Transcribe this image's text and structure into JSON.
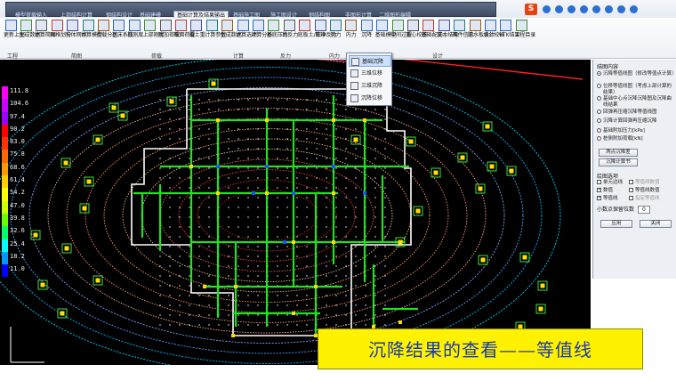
{
  "tabs": [
    "模型荷载输入",
    "上部结构计算",
    "钢结构设计",
    "基础建模",
    "基础计算及结果输出",
    "基础施工图",
    "施工图设计",
    "钢结构图",
    "非图形计算",
    "二维图形编辑"
  ],
  "active_tab_index": 4,
  "ribbon": {
    "buttons": [
      "更新上部",
      "生成数据",
      "计算简图",
      "网格划分",
      "实体网格",
      "计算模型",
      "荷载分区",
      "基床系数",
      "柱刚度",
      "上部刚度",
      "附加荷载",
      "桩面荷载",
      "覆土重",
      "计算参数",
      "生成数据",
      "计算选项",
      "计算分析",
      "基底压力",
      "桩反力",
      "底板土/桩净反力",
      "弯矩",
      "剪力",
      "内力",
      "沉降",
      "基础模型",
      "中间过程",
      "重心校核",
      "基础配筋",
      "文本结果",
      "构件信息",
      "防水板设计",
      "承台校核",
      "VTK结果",
      "工程目录"
    ],
    "groups": [
      "工程",
      "简图",
      "荷载",
      "计算",
      "反力",
      "内力",
      "设计"
    ]
  },
  "dropdown": {
    "items": [
      "基础沉降",
      "三维位移",
      "三维沉降",
      "沉降位移"
    ],
    "selected_index": 0
  },
  "legend": {
    "values": [
      "111.8",
      "104.6",
      "97.4",
      "90.2",
      "83.0",
      "75.8",
      "68.6",
      "61.4",
      "54.2",
      "47.0",
      "39.8",
      "32.6",
      "25.4",
      "18.2",
      "11.0"
    ],
    "colors": [
      "#ff00ff",
      "#cc00ff",
      "#9900ff",
      "#ff0000",
      "#ff3300",
      "#ff6600",
      "#ff9900",
      "#ffcc00",
      "#ffff00",
      "#ccff00",
      "#66ff00",
      "#00ff66",
      "#00ffff",
      "#0099ff",
      "#0000ff"
    ]
  },
  "caption": "沉降结果的查看——等值线",
  "panel": {
    "title": "结图内容",
    "options": [
      "沉降等值线图（修改等值点计算）",
      "位移等值线图（考虑上部计算的结果）",
      "基础中心点沉降沉降图及沉降曲线结果",
      "回弹再压缩沉降等值线图",
      "沉降计算回弹再压缩沉降",
      "基础附加压力[kPa]",
      "桩侧附加荷载[kN]"
    ],
    "selected_option": 0,
    "buttons": [
      "两点沉降差",
      "沉降计算书"
    ],
    "subtitle": "绘图选项",
    "checks": [
      {
        "label": "单元边线",
        "checked": false,
        "disabled": false
      },
      {
        "label": "等值线数值",
        "checked": false,
        "disabled": true
      },
      {
        "label": "数值",
        "checked": true,
        "disabled": false
      },
      {
        "label": "等值线数值",
        "checked": false,
        "disabled": false
      },
      {
        "label": "等值线",
        "checked": true,
        "disabled": false
      },
      {
        "label": "指定等值线",
        "checked": false,
        "disabled": true
      }
    ],
    "decimal_label": "小数点保留位数",
    "decimal_value": "0",
    "apply": "应用",
    "close": "关闭"
  }
}
